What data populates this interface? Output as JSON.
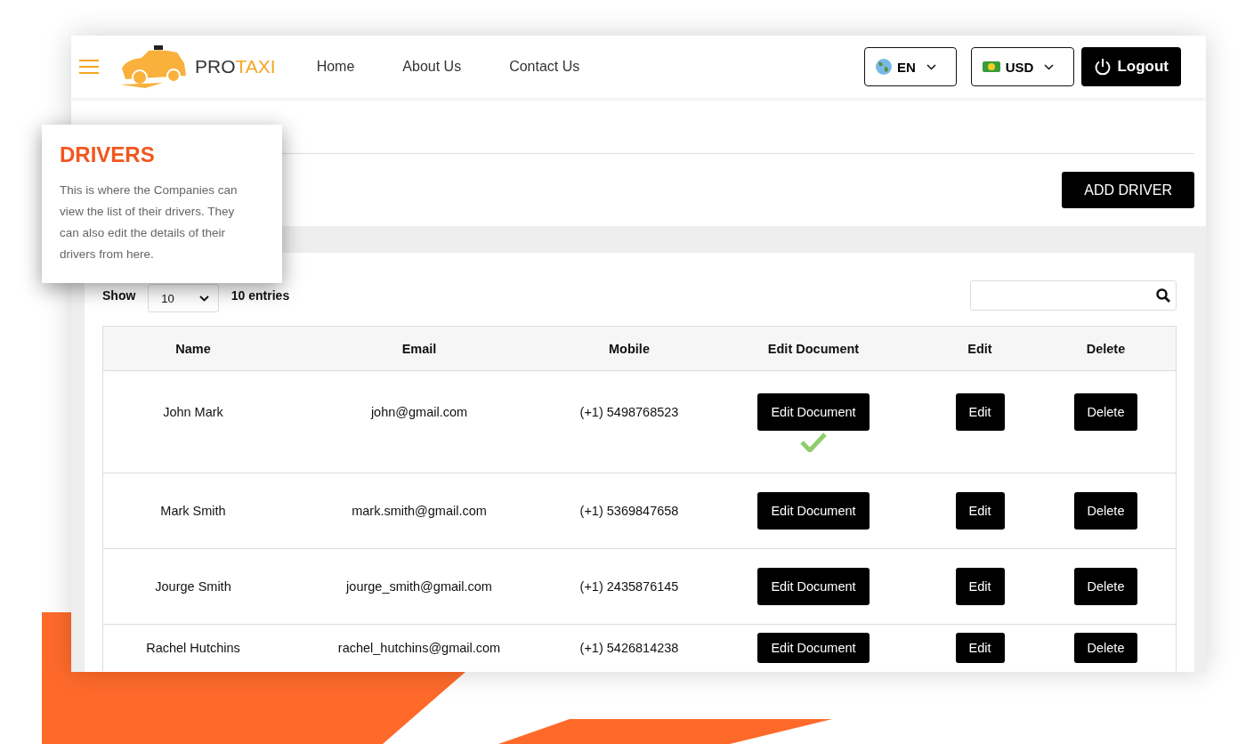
{
  "header": {
    "brand": {
      "prefix": "PRO",
      "suffix": "TAXI"
    },
    "nav": [
      {
        "label": "Home"
      },
      {
        "label": "About Us"
      },
      {
        "label": "Contact Us"
      }
    ],
    "language": {
      "value": "EN"
    },
    "currency": {
      "value": "USD"
    },
    "logout": "Logout"
  },
  "toolbar": {
    "add_button": "ADD DRIVER"
  },
  "entries": {
    "show_label": "Show",
    "page_size": "10",
    "summary": "10 entries"
  },
  "table": {
    "columns": [
      "Name",
      "Email",
      "Mobile",
      "Edit Document",
      "Edit",
      "Delete"
    ],
    "rows": [
      {
        "name": "John Mark",
        "email": "john@gmail.com",
        "mobile": "(+1) 5498768523",
        "edit_document": "Edit Document",
        "edit": "Edit",
        "delete": "Delete",
        "document_verified": true
      },
      {
        "name": "Mark Smith",
        "email": "mark.smith@gmail.com",
        "mobile": "(+1) 5369847658",
        "edit_document": "Edit Document",
        "edit": "Edit",
        "delete": "Delete",
        "document_verified": false
      },
      {
        "name": "Jourge Smith",
        "email": "jourge_smith@gmail.com",
        "mobile": "(+1) 2435876145",
        "edit_document": "Edit Document",
        "edit": "Edit",
        "delete": "Delete",
        "document_verified": false
      },
      {
        "name": "Rachel Hutchins",
        "email": "rachel_hutchins@gmail.com",
        "mobile": "(+1) 5426814238",
        "edit_document": "Edit Document",
        "edit": "Edit",
        "delete": "Delete",
        "document_verified": false
      }
    ]
  },
  "callout": {
    "title": "DRIVERS",
    "text": "This is where the Companies can view the list of their drivers. They can also edit the details of their drivers from here."
  }
}
